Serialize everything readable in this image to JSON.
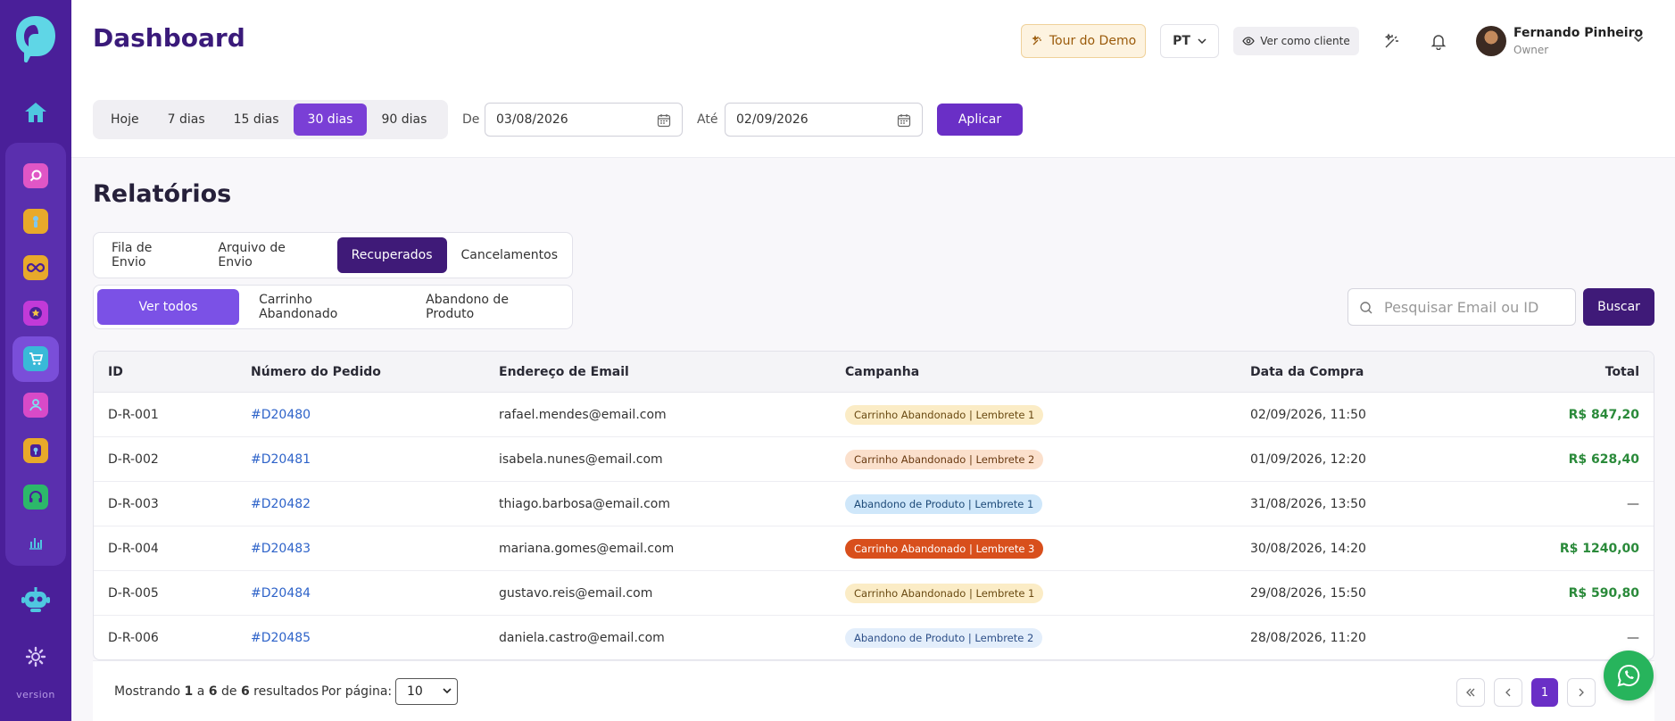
{
  "sidebar": {
    "version_label": "version",
    "items": [
      {
        "icon": "search-icon",
        "color": "#e056c6"
      },
      {
        "icon": "info-icon",
        "color": "#e8a92a"
      },
      {
        "icon": "infinity-icon",
        "color": "#e8a92a"
      },
      {
        "icon": "star-icon",
        "color": "#c23ad8"
      },
      {
        "icon": "cart-icon",
        "color": "#39b9d8",
        "active": true
      },
      {
        "icon": "user-icon",
        "color": "#d84ac8"
      },
      {
        "icon": "lock-icon",
        "color": "#e8a92a"
      },
      {
        "icon": "headset-icon",
        "color": "#2cb86a"
      },
      {
        "icon": "chart-icon",
        "color": "#5a2fae"
      }
    ]
  },
  "header": {
    "title": "Dashboard",
    "tour_label": "Tour do Demo",
    "lang_label": "PT",
    "client_view_label": "Ver como cliente",
    "user_name": "Fernando Pinheiro",
    "user_role": "Owner"
  },
  "filters": {
    "ranges": [
      "Hoje",
      "7 dias",
      "15 dias",
      "30 dias",
      "90 dias"
    ],
    "active_range": "30 dias",
    "from_label": "De",
    "from_value": "03/08/2026",
    "to_label": "Até",
    "to_value": "02/09/2026",
    "apply_label": "Aplicar"
  },
  "reports": {
    "title": "Relatórios",
    "tabs": [
      "Fila de Envio",
      "Arquivo de Envio",
      "Recuperados",
      "Cancelamentos"
    ],
    "active_tab": "Recuperados",
    "subtabs": [
      "Ver todos",
      "Carrinho Abandonado",
      "Abandono de Produto"
    ],
    "active_subtab": "Ver todos",
    "search_placeholder": "Pesquisar Email ou ID",
    "search_button": "Buscar"
  },
  "table": {
    "columns": [
      "ID",
      "Número do Pedido",
      "Endereço de Email",
      "Campanha",
      "Data da Compra",
      "Total"
    ],
    "rows": [
      {
        "id": "D-R-001",
        "order": "#D20480",
        "email": "rafael.mendes@email.com",
        "campaign": "Carrinho Abandonado | Lembrete 1",
        "campaign_style": "y",
        "date": "02/09/2026, 11:50",
        "total": "R$ 847,20"
      },
      {
        "id": "D-R-002",
        "order": "#D20481",
        "email": "isabela.nunes@email.com",
        "campaign": "Carrinho Abandonado | Lembrete 2",
        "campaign_style": "o",
        "date": "01/09/2026, 12:20",
        "total": "R$ 628,40"
      },
      {
        "id": "D-R-003",
        "order": "#D20482",
        "email": "thiago.barbosa@email.com",
        "campaign": "Abandono de Produto | Lembrete 1",
        "campaign_style": "b",
        "date": "31/08/2026, 13:50",
        "total": "—"
      },
      {
        "id": "D-R-004",
        "order": "#D20483",
        "email": "mariana.gomes@email.com",
        "campaign": "Carrinho Abandonado | Lembrete 3",
        "campaign_style": "r",
        "date": "30/08/2026, 14:20",
        "total": "R$ 1240,00"
      },
      {
        "id": "D-R-005",
        "order": "#D20484",
        "email": "gustavo.reis@email.com",
        "campaign": "Carrinho Abandonado | Lembrete 1",
        "campaign_style": "y",
        "date": "29/08/2026, 15:50",
        "total": "R$ 590,80"
      },
      {
        "id": "D-R-006",
        "order": "#D20485",
        "email": "daniela.castro@email.com",
        "campaign": "Abandono de Produto | Lembrete 2",
        "campaign_style": "lb",
        "date": "28/08/2026, 11:20",
        "total": "—"
      }
    ]
  },
  "pagination": {
    "showing_prefix": "Mostrando",
    "from": "1",
    "to_word": "a",
    "to": "6",
    "of_word": "de",
    "total": "6",
    "suffix": "resultados",
    "per_page_label": "Por página:",
    "per_page_value": "10",
    "current_page": "1"
  }
}
